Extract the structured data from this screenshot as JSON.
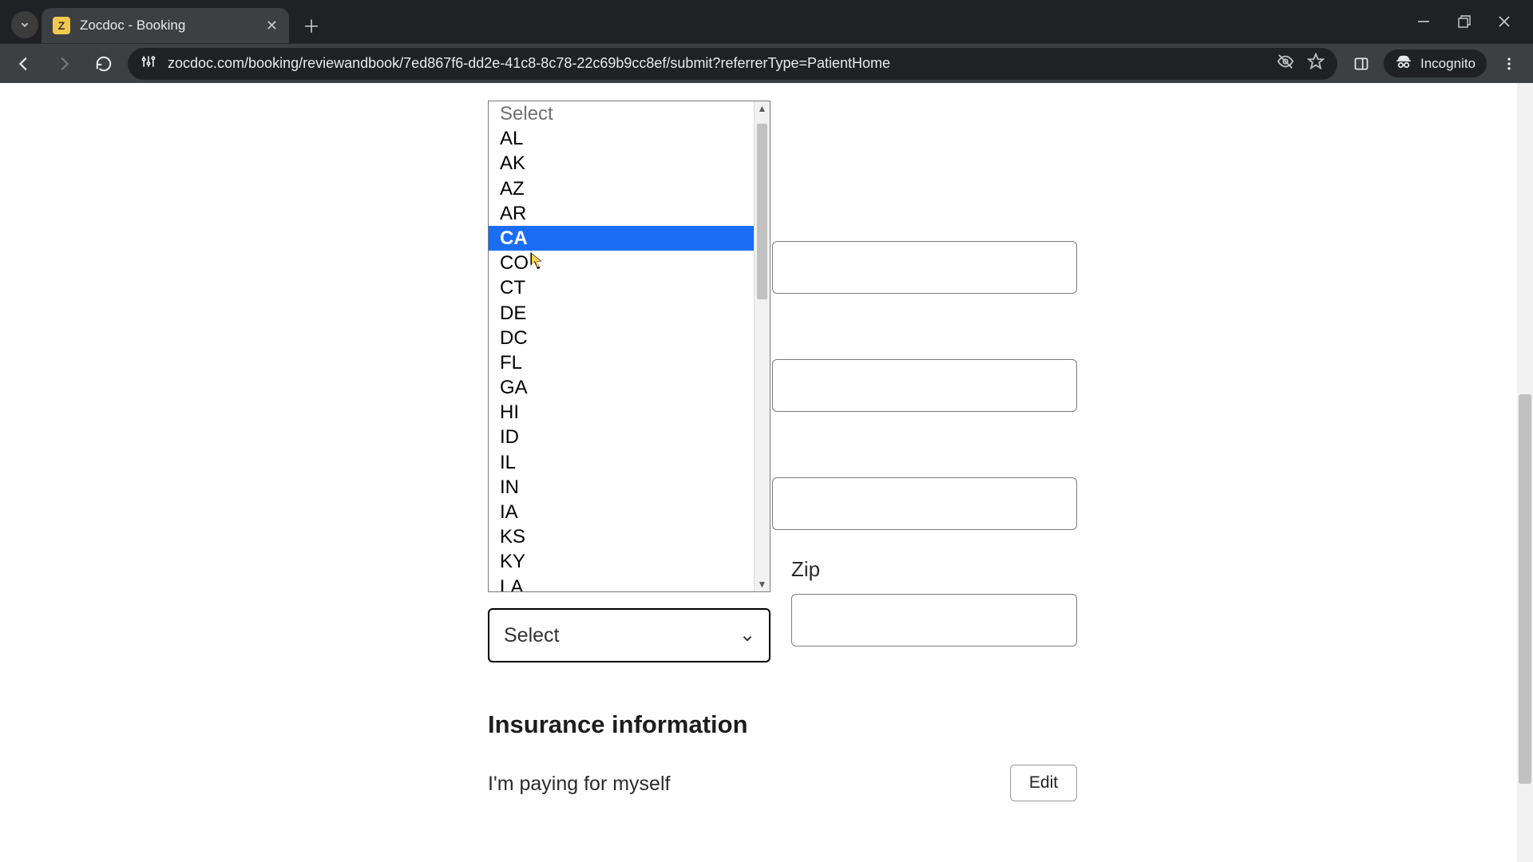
{
  "browser": {
    "tab_title": "Zocdoc - Booking",
    "favicon_letter": "Z",
    "url": "zocdoc.com/booking/reviewandbook/7ed867f6-dd2e-41c8-8c78-22c69b9cc8ef/submit?referrerType=PatientHome",
    "incognito_label": "Incognito"
  },
  "state_dropdown": {
    "placeholder": "Select",
    "highlighted": "CA",
    "options": [
      "AL",
      "AK",
      "AZ",
      "AR",
      "CA",
      "CO",
      "CT",
      "DE",
      "DC",
      "FL",
      "GA",
      "HI",
      "ID",
      "IL",
      "IN",
      "IA",
      "KS",
      "KY",
      "LA"
    ]
  },
  "state_select_value": "Select",
  "zip_label": "Zip",
  "insurance": {
    "heading": "Insurance information",
    "text": "I'm paying for myself",
    "edit_label": "Edit"
  }
}
